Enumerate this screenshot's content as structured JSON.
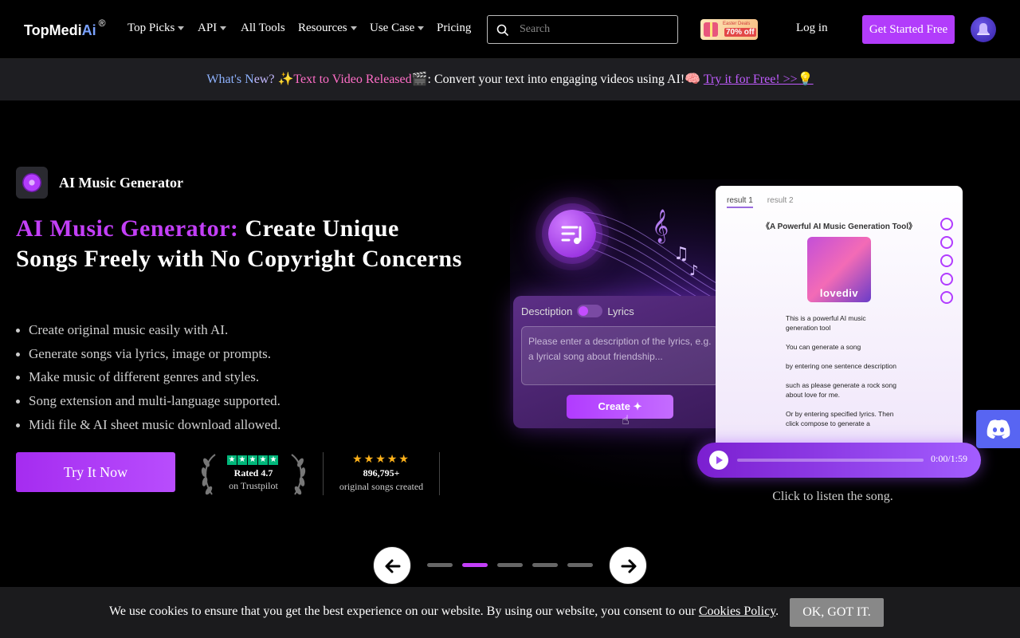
{
  "nav": {
    "logo_main": "TopMedi",
    "logo_accent": "Ai",
    "logo_mark": "®",
    "items": [
      {
        "label": "Top Picks",
        "has_caret": true
      },
      {
        "label": "API",
        "has_caret": true
      },
      {
        "label": "All Tools",
        "has_caret": false
      },
      {
        "label": "Resources",
        "has_caret": true
      },
      {
        "label": "Use Case",
        "has_caret": true
      },
      {
        "label": "Pricing",
        "has_caret": false
      }
    ],
    "search_placeholder": "Search",
    "search_icon": "search-icon",
    "promo_top": "Easter Deals",
    "promo_main": "70% off",
    "login": "Log in",
    "cta": "Get Started Free",
    "bell_icon": "bell-icon"
  },
  "banner": {
    "part1": "What's N",
    "part2": "ew? ",
    "part3": "✨Text to Video Released",
    "part4": "🎬: Convert your text into engaging videos using AI!🧠 ",
    "link": "Try it for Free! >>💡"
  },
  "hero": {
    "badge": "AI Music Generator",
    "title_highlight": "AI Music Generator:",
    "title_rest": " Create Unique Songs Freely with No Copyright Concerns",
    "features": [
      "Create original music easily with AI.",
      "Generate songs via lyrics, image or prompts.",
      "Make music of different genres and styles.",
      "Song extension and multi-language supported.",
      "Midi file & AI sheet music download allowed."
    ],
    "cta": "Try It Now",
    "trustpilot_rated": "Rated 4.7",
    "trustpilot_on": "on Trustpilot",
    "songs_stars": "★★★★★",
    "songs_count": "896,795+",
    "songs_label": "original songs created"
  },
  "illustration": {
    "tab_desc": "Desctiption",
    "tab_lyrics": "Lyrics",
    "placeholder": "Please enter a description of the lyrics, e.g. a lyrical song about friendship...",
    "create": "Create ✦",
    "result1": "result 1",
    "result2": "result 2",
    "song_title": "《A Powerful AI Music Generation Tool》",
    "cover_text": "lovediv",
    "lyrics": [
      "This is a powerful AI music generation tool",
      "You can generate a song",
      "by entering one sentence description",
      "such as please generate a rock song about love for me.",
      "Or by entering specified lyrics. Then click compose to generate a"
    ],
    "time": "0:00/1:59",
    "listen": "Click to listen the song."
  },
  "carousel": {
    "dots": 5,
    "active": 2
  },
  "cookie": {
    "text": "We use cookies to ensure that you get the best experience on our website. By using our website, you consent to our ",
    "link": "Cookies Policy",
    "end": ".",
    "ok": "OK, GOT IT."
  },
  "colors": {
    "accent": "#b23cfb",
    "highlight": "#c33ff7",
    "discord": "#5865f2",
    "trustpilot": "#00b67a"
  }
}
